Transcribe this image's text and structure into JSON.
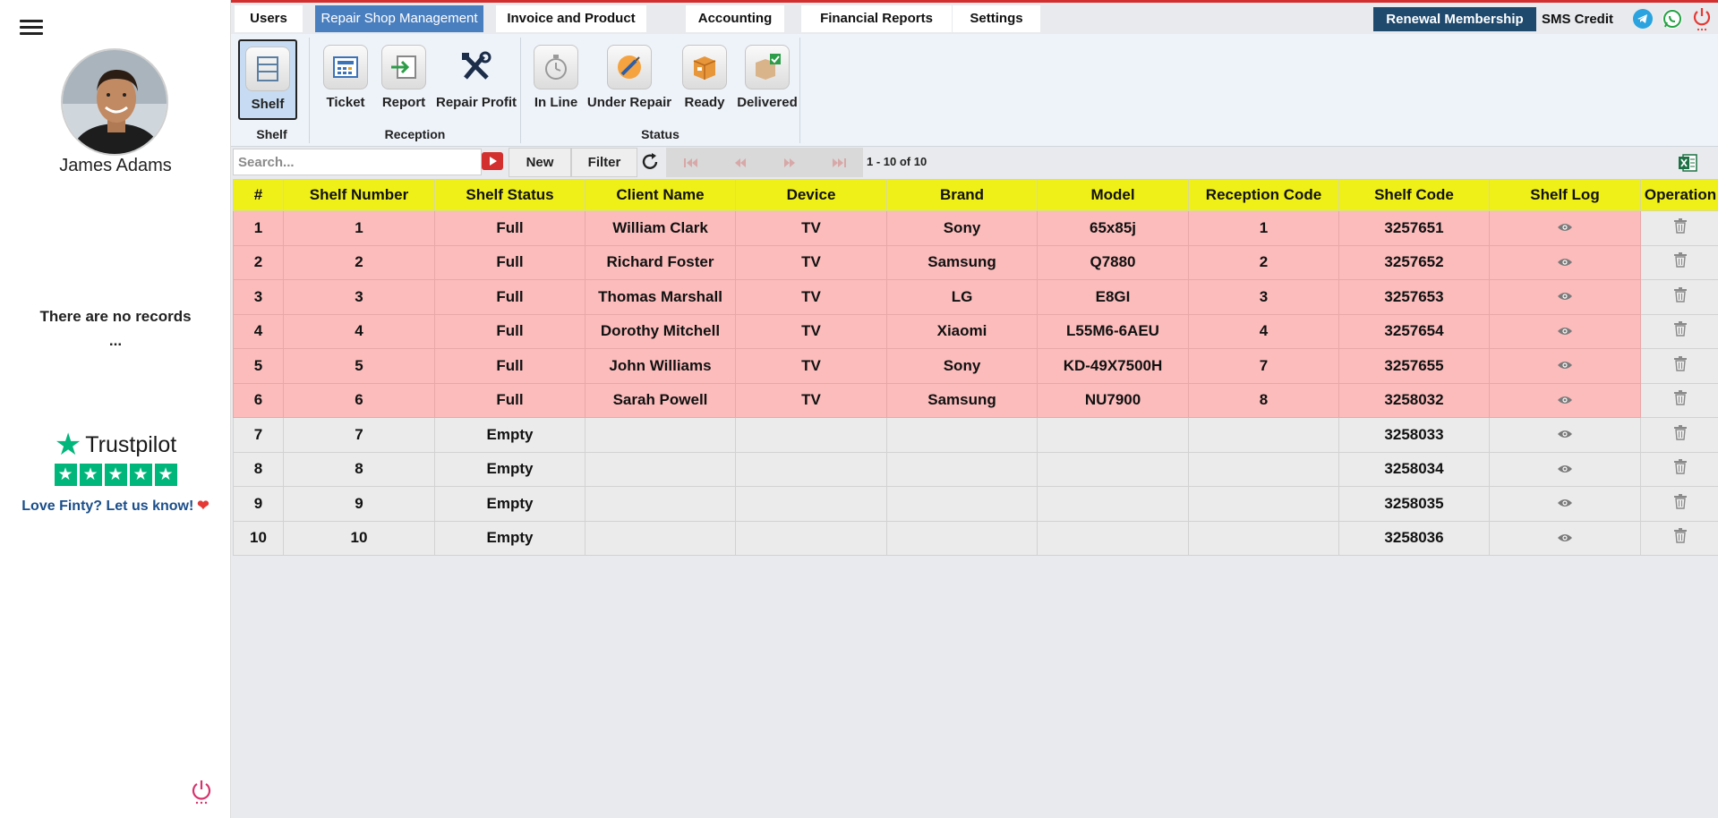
{
  "sidebar": {
    "user_name": "James Adams",
    "no_records_line1": "There are no records",
    "no_records_line2": "...",
    "trustpilot_name": "Trustpilot",
    "trustpilot_cta": "Love Finty? Let us know!"
  },
  "tabs": [
    {
      "label": "Users",
      "active": false
    },
    {
      "label": "Repair Shop Management",
      "active": true
    },
    {
      "label": "Invoice and Product",
      "active": false
    },
    {
      "label": "Accounting",
      "active": false
    },
    {
      "label": "Financial Reports",
      "active": false
    },
    {
      "label": "Settings",
      "active": false
    }
  ],
  "header": {
    "renewal_label": "Renewal Membership",
    "sms_label": "SMS Credit"
  },
  "ribbon": {
    "groups": [
      {
        "title": "Shelf",
        "buttons": [
          {
            "label": "Shelf",
            "icon": "shelf-icon",
            "active": true
          }
        ]
      },
      {
        "title": "Reception",
        "buttons": [
          {
            "label": "Ticket",
            "icon": "ticket-icon"
          },
          {
            "label": "Report",
            "icon": "report-icon"
          },
          {
            "label": "Repair Profit",
            "icon": "tools-icon"
          }
        ]
      },
      {
        "title": "Status",
        "buttons": [
          {
            "label": "In Line",
            "icon": "stopwatch-icon"
          },
          {
            "label": "Under Repair",
            "icon": "screwdriver-icon"
          },
          {
            "label": "Ready",
            "icon": "box-icon"
          },
          {
            "label": "Delivered",
            "icon": "box-check-icon"
          }
        ]
      }
    ]
  },
  "toolbar": {
    "search_placeholder": "Search...",
    "new_label": "New",
    "filter_label": "Filter",
    "page_info": "1 - 10 of 10"
  },
  "table": {
    "columns": [
      "#",
      "Shelf Number",
      "Shelf Status",
      "Client Name",
      "Device",
      "Brand",
      "Model",
      "Reception Code",
      "Shelf Code",
      "Shelf Log",
      "Operation"
    ],
    "rows": [
      {
        "n": "1",
        "shelf": "1",
        "status": "Full",
        "client": "William Clark",
        "device": "TV",
        "brand": "Sony",
        "model": "65x85j",
        "reception": "1",
        "code": "3257651"
      },
      {
        "n": "2",
        "shelf": "2",
        "status": "Full",
        "client": "Richard Foster",
        "device": "TV",
        "brand": "Samsung",
        "model": "Q7880",
        "reception": "2",
        "code": "3257652"
      },
      {
        "n": "3",
        "shelf": "3",
        "status": "Full",
        "client": "Thomas Marshall",
        "device": "TV",
        "brand": "LG",
        "model": "E8GI",
        "reception": "3",
        "code": "3257653"
      },
      {
        "n": "4",
        "shelf": "4",
        "status": "Full",
        "client": "Dorothy Mitchell",
        "device": "TV",
        "brand": "Xiaomi",
        "model": "L55M6-6AEU",
        "reception": "4",
        "code": "3257654"
      },
      {
        "n": "5",
        "shelf": "5",
        "status": "Full",
        "client": "John Williams",
        "device": "TV",
        "brand": "Sony",
        "model": "KD-49X7500H",
        "reception": "7",
        "code": "3257655"
      },
      {
        "n": "6",
        "shelf": "6",
        "status": "Full",
        "client": "Sarah Powell",
        "device": "TV",
        "brand": "Samsung",
        "model": "NU7900",
        "reception": "8",
        "code": "3258032"
      },
      {
        "n": "7",
        "shelf": "7",
        "status": "Empty",
        "client": "",
        "device": "",
        "brand": "",
        "model": "",
        "reception": "",
        "code": "3258033"
      },
      {
        "n": "8",
        "shelf": "8",
        "status": "Empty",
        "client": "",
        "device": "",
        "brand": "",
        "model": "",
        "reception": "",
        "code": "3258034"
      },
      {
        "n": "9",
        "shelf": "9",
        "status": "Empty",
        "client": "",
        "device": "",
        "brand": "",
        "model": "",
        "reception": "",
        "code": "3258035"
      },
      {
        "n": "10",
        "shelf": "10",
        "status": "Empty",
        "client": "",
        "device": "",
        "brand": "",
        "model": "",
        "reception": "",
        "code": "3258036"
      }
    ]
  },
  "colors": {
    "accent_red": "#d32f2f",
    "tab_active": "#4a7fbf",
    "renewal_bg": "#1f4a6e",
    "header_yellow": "#f0f019",
    "row_full": "#fcbcbc",
    "row_empty": "#ebebeb",
    "trustpilot_green": "#00b67a"
  }
}
